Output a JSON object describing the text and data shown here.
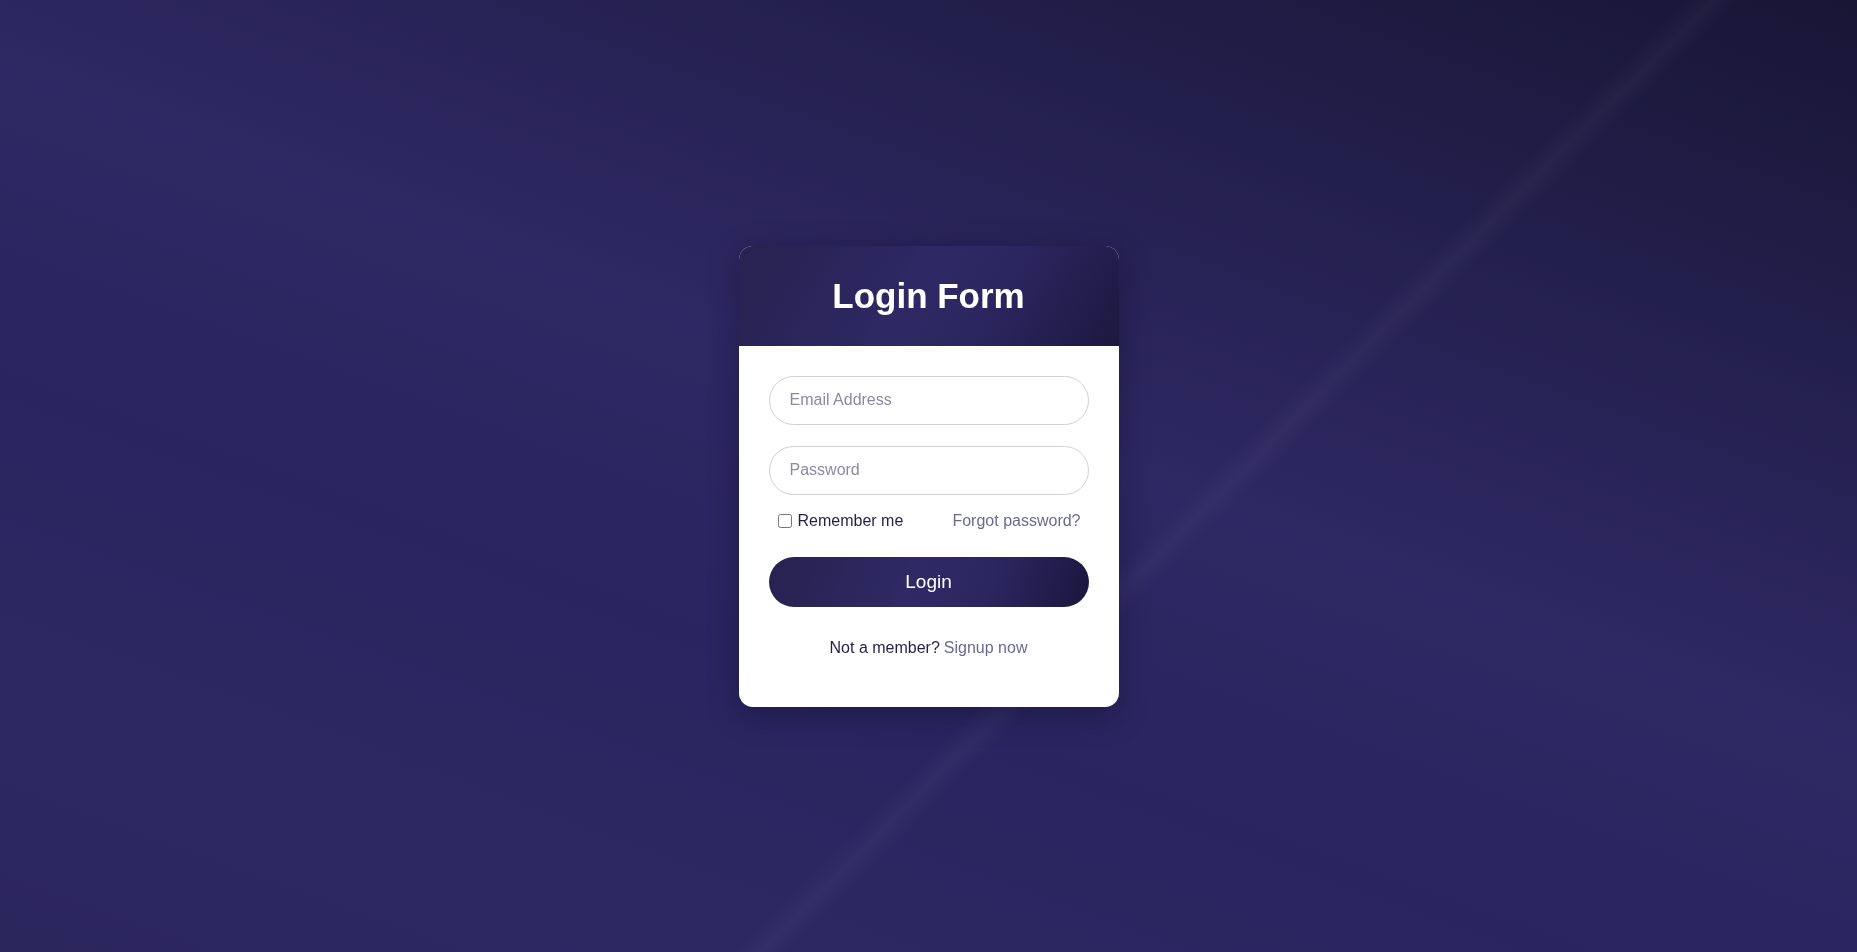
{
  "header": {
    "title": "Login Form"
  },
  "fields": [
    {
      "placeholder": "Email Address"
    },
    {
      "placeholder": "Password"
    }
  ],
  "remember": {
    "label": "Remember me",
    "checked": false
  },
  "forgot_link": "Forgot password?",
  "login_button": "Login",
  "signup": {
    "prompt": "Not a member?",
    "link": "Signup now"
  }
}
